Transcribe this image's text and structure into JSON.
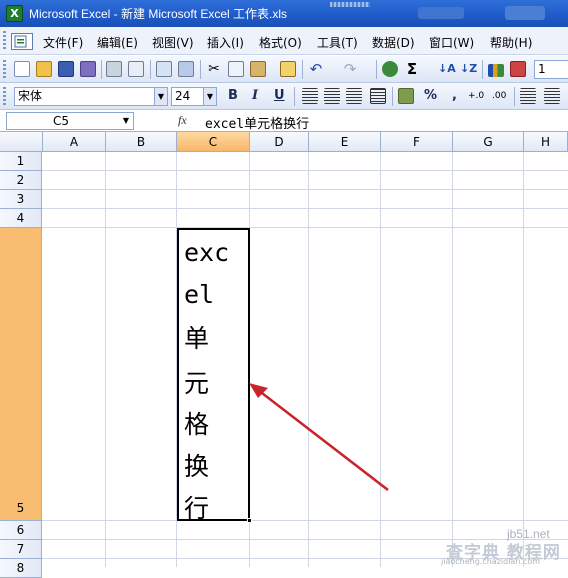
{
  "window": {
    "title": "Microsoft Excel - 新建 Microsoft Excel 工作表.xls",
    "app_icon": "excel-icon"
  },
  "menu": [
    "文件(F)",
    "编辑(E)",
    "视图(V)",
    "插入(I)",
    "格式(O)",
    "工具(T)",
    "数据(D)",
    "窗口(W)",
    "帮助(H)"
  ],
  "toolbar_format": {
    "font_name": "宋体",
    "font_size": "24",
    "bold": "B",
    "italic": "I",
    "underline": "U",
    "percent": "%",
    "comma": ","
  },
  "formula_bar": {
    "name_box": "C5",
    "fx": "fx",
    "content": "excel单元格换行"
  },
  "columns": [
    "A",
    "B",
    "C",
    "D",
    "E",
    "F",
    "G",
    "H"
  ],
  "rows": [
    "1",
    "2",
    "3",
    "4",
    "5",
    "6",
    "7",
    "8"
  ],
  "active_cell": {
    "lines": [
      "exc",
      "el",
      "单",
      "元",
      "格",
      "换",
      "行"
    ]
  },
  "watermark": {
    "site": "jb51.net",
    "brand": "查字典 教程网",
    "url": "jiaocheng.chazidian.com"
  },
  "colors": {
    "accent": "#1f5bc8",
    "selected_header": "#f9bd71",
    "arrow": "#c8242b"
  }
}
